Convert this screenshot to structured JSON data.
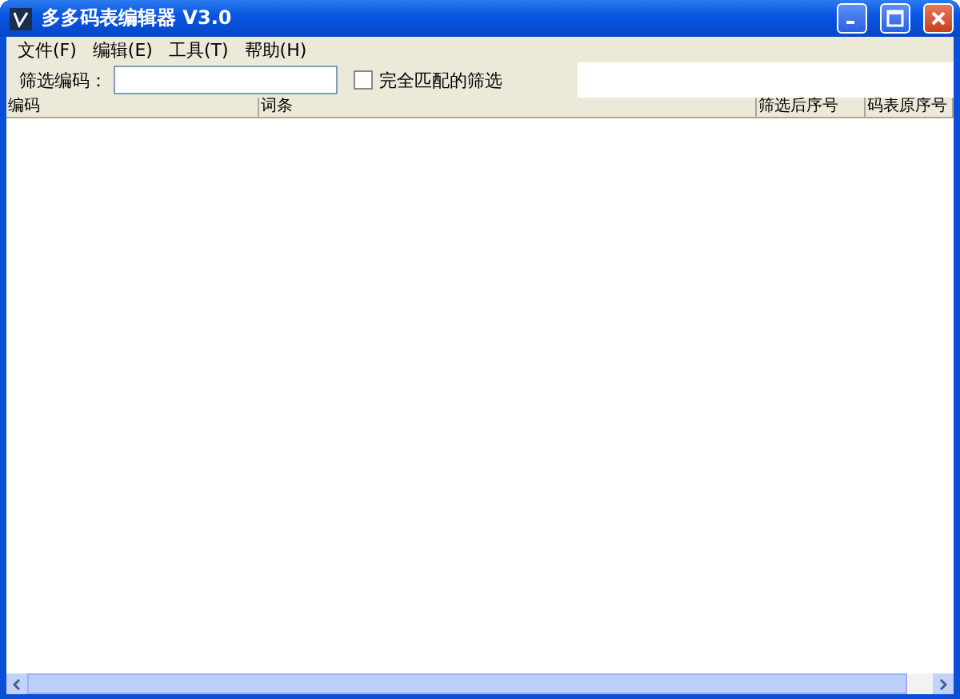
{
  "window": {
    "title": "多多码表编辑器 V3.0"
  },
  "menu": [
    {
      "label": "文件(F)"
    },
    {
      "label": "编辑(E)"
    },
    {
      "label": "工具(T)"
    },
    {
      "label": "帮助(H)"
    }
  ],
  "filter": {
    "label": "筛选编码：",
    "exact_match": {
      "label": "完全匹配的筛选",
      "checked": false
    }
  },
  "table": {
    "columns": [
      "编码",
      "词条",
      "筛选后序号",
      "码表原序号"
    ]
  }
}
